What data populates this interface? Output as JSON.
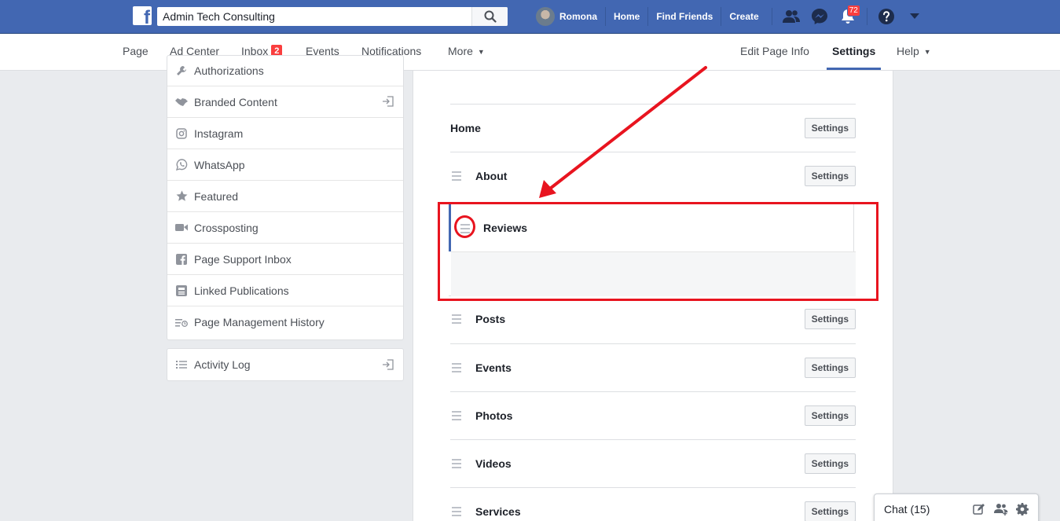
{
  "topbar": {
    "search_value": "Admin Tech Consulting",
    "user_name": "Romona",
    "links": [
      "Home",
      "Find Friends",
      "Create"
    ],
    "notifications_count": "72"
  },
  "pagebar": {
    "tabs_left": [
      {
        "label": "Page"
      },
      {
        "label": "Ad Center"
      },
      {
        "label": "Inbox",
        "badge": "2"
      },
      {
        "label": "Events"
      },
      {
        "label": "Notifications"
      },
      {
        "label": "More"
      }
    ],
    "tabs_right": [
      {
        "label": "Edit Page Info"
      },
      {
        "label": "Settings"
      },
      {
        "label": "Help"
      }
    ]
  },
  "leftmenu": {
    "items": [
      {
        "label": "Authorizations",
        "icon": "wrench-icon"
      },
      {
        "label": "Branded Content",
        "icon": "handshake-icon"
      },
      {
        "label": "Instagram",
        "icon": "instagram-icon"
      },
      {
        "label": "WhatsApp",
        "icon": "whatsapp-icon"
      },
      {
        "label": "Featured",
        "icon": "star-icon"
      },
      {
        "label": "Crossposting",
        "icon": "video-camera-icon"
      },
      {
        "label": "Page Support Inbox",
        "icon": "facebook-icon"
      },
      {
        "label": "Linked Publications",
        "icon": "publication-icon"
      },
      {
        "label": "Page Management History",
        "icon": "history-icon"
      }
    ],
    "activity_log": "Activity Log"
  },
  "tabs": {
    "settings_label": "Settings",
    "rows": [
      {
        "label": "Home"
      },
      {
        "label": "About"
      },
      {
        "label": "Reviews"
      },
      {
        "label": "Posts"
      },
      {
        "label": "Events"
      },
      {
        "label": "Photos"
      },
      {
        "label": "Videos"
      },
      {
        "label": "Services"
      }
    ]
  },
  "chat": {
    "label": "Chat (15)"
  },
  "colors": {
    "brand_blue": "#4267b2",
    "annotation_red": "#e8141f",
    "badge_red": "#fa3e3e"
  }
}
